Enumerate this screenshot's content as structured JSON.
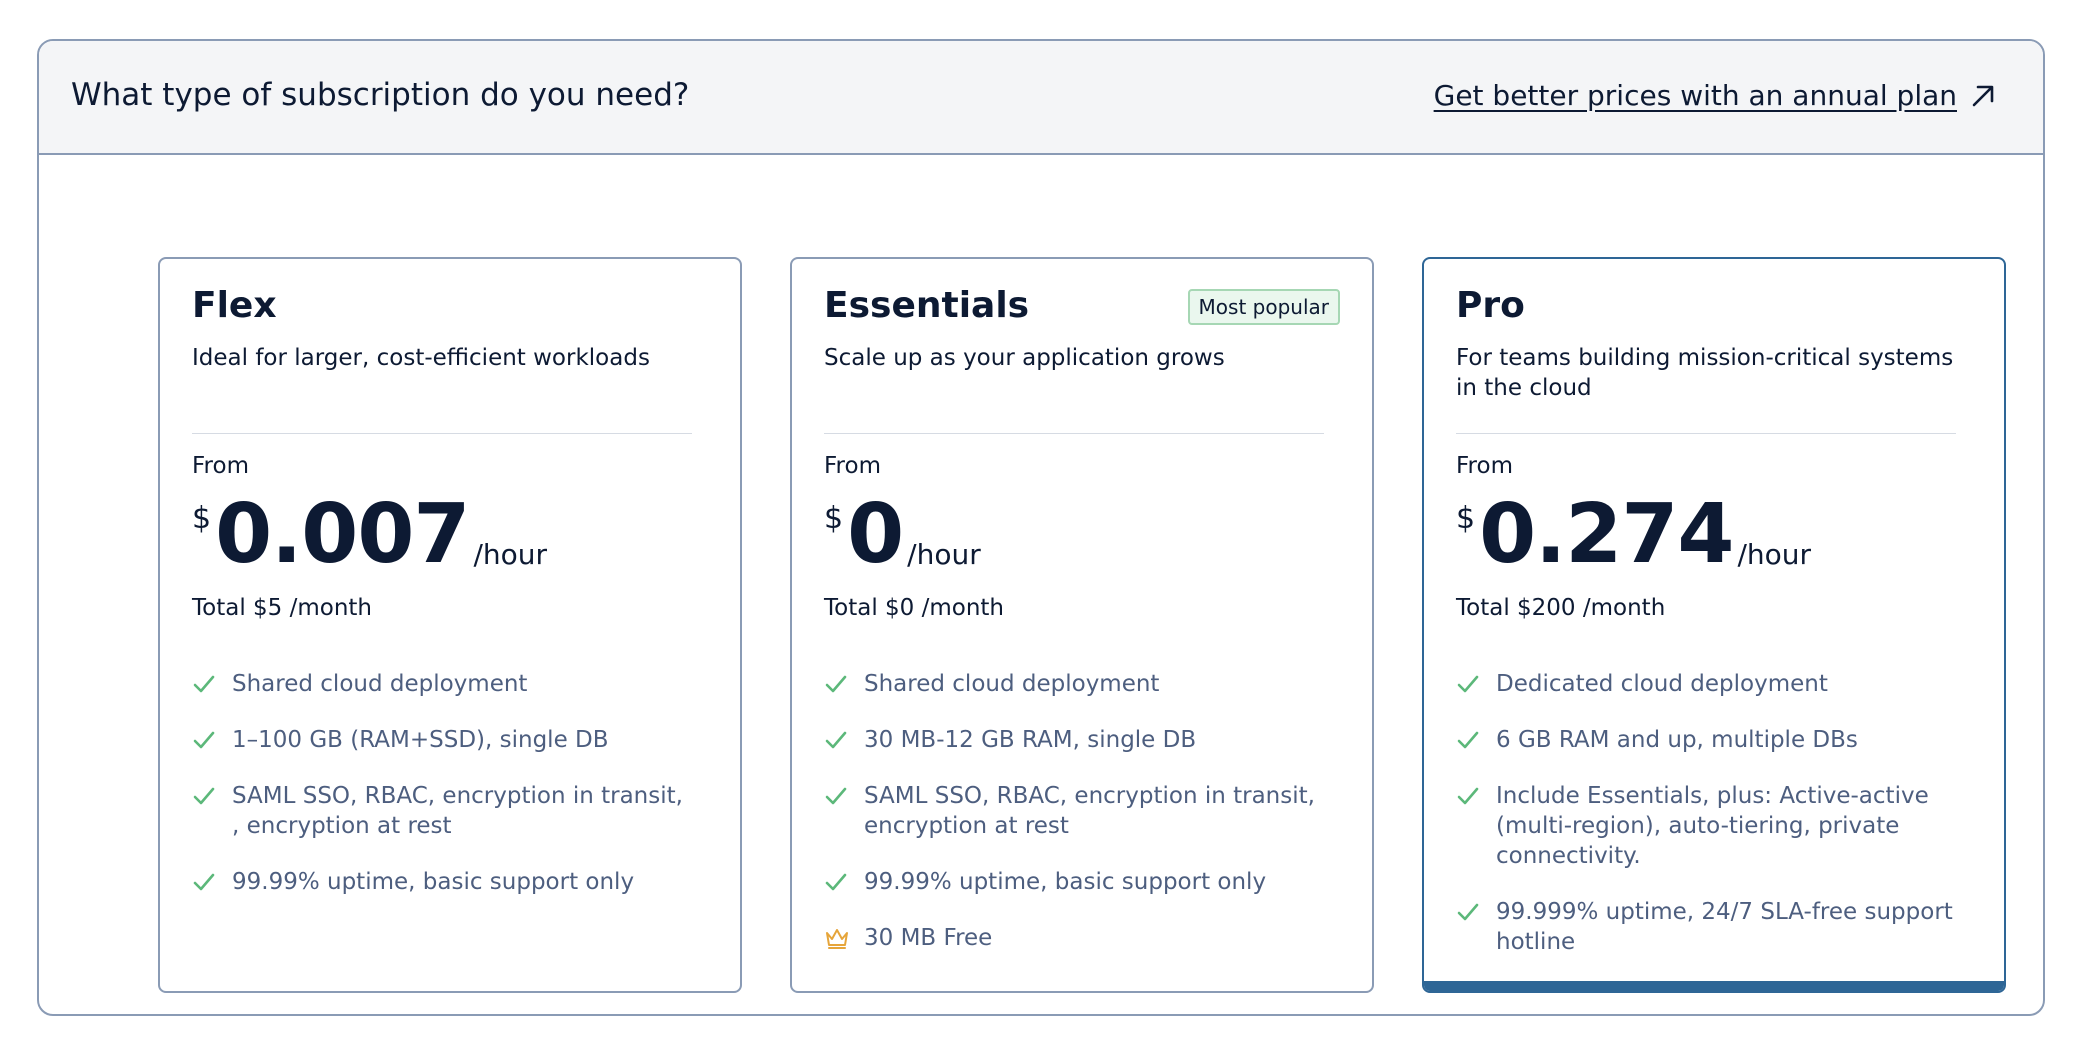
{
  "header": {
    "title": "What type of subscription do you need?",
    "annual_link": "Get better prices with an annual plan",
    "annual_link_icon": "arrow-up-right-icon"
  },
  "colors": {
    "check": "#5cb87a",
    "crown": "#e6a53a",
    "selected_border": "#2e6696",
    "badge_bg": "#eaf7ee"
  },
  "plans": [
    {
      "name": "Flex",
      "description": "Ideal for larger, cost-efficient workloads",
      "from_label": "From",
      "currency": "$",
      "price": "0.007",
      "unit": "/hour",
      "total": "Total $5 /month",
      "selected": false,
      "features": [
        {
          "icon": "check-icon",
          "text": "Shared cloud deployment"
        },
        {
          "icon": "check-icon",
          "text": "1–100 GB (RAM+SSD), single DB"
        },
        {
          "icon": "check-icon",
          "text": "SAML SSO, RBAC, encryption in transit, , encryption at rest"
        },
        {
          "icon": "check-icon",
          "text": "99.99% uptime, basic support only"
        }
      ]
    },
    {
      "name": "Essentials",
      "badge": "Most popular",
      "description": "Scale up as your application grows",
      "from_label": "From",
      "currency": "$",
      "price": "0",
      "unit": "/hour",
      "total": "Total $0 /month",
      "selected": false,
      "features": [
        {
          "icon": "check-icon",
          "text": "Shared cloud deployment"
        },
        {
          "icon": "check-icon",
          "text": "30 MB-12 GB RAM, single DB"
        },
        {
          "icon": "check-icon",
          "text": "SAML SSO, RBAC, encryption in transit, encryption at rest"
        },
        {
          "icon": "check-icon",
          "text": "99.99% uptime, basic support only"
        },
        {
          "icon": "crown-icon",
          "text": "30 MB Free"
        }
      ]
    },
    {
      "name": "Pro",
      "description": "For teams building mission-critical systems in the cloud",
      "from_label": "From",
      "currency": "$",
      "price": "0.274",
      "unit": "/hour",
      "total": "Total $200 /month",
      "selected": true,
      "features": [
        {
          "icon": "check-icon",
          "text": "Dedicated cloud deployment"
        },
        {
          "icon": "check-icon",
          "text": "6 GB RAM and up, multiple DBs"
        },
        {
          "icon": "check-icon",
          "text": "Include Essentials, plus: Active-active (multi-region), auto-tiering, private connectivity."
        },
        {
          "icon": "check-icon",
          "text": "99.999% uptime, 24/7 SLA-free support hotline"
        }
      ]
    }
  ]
}
